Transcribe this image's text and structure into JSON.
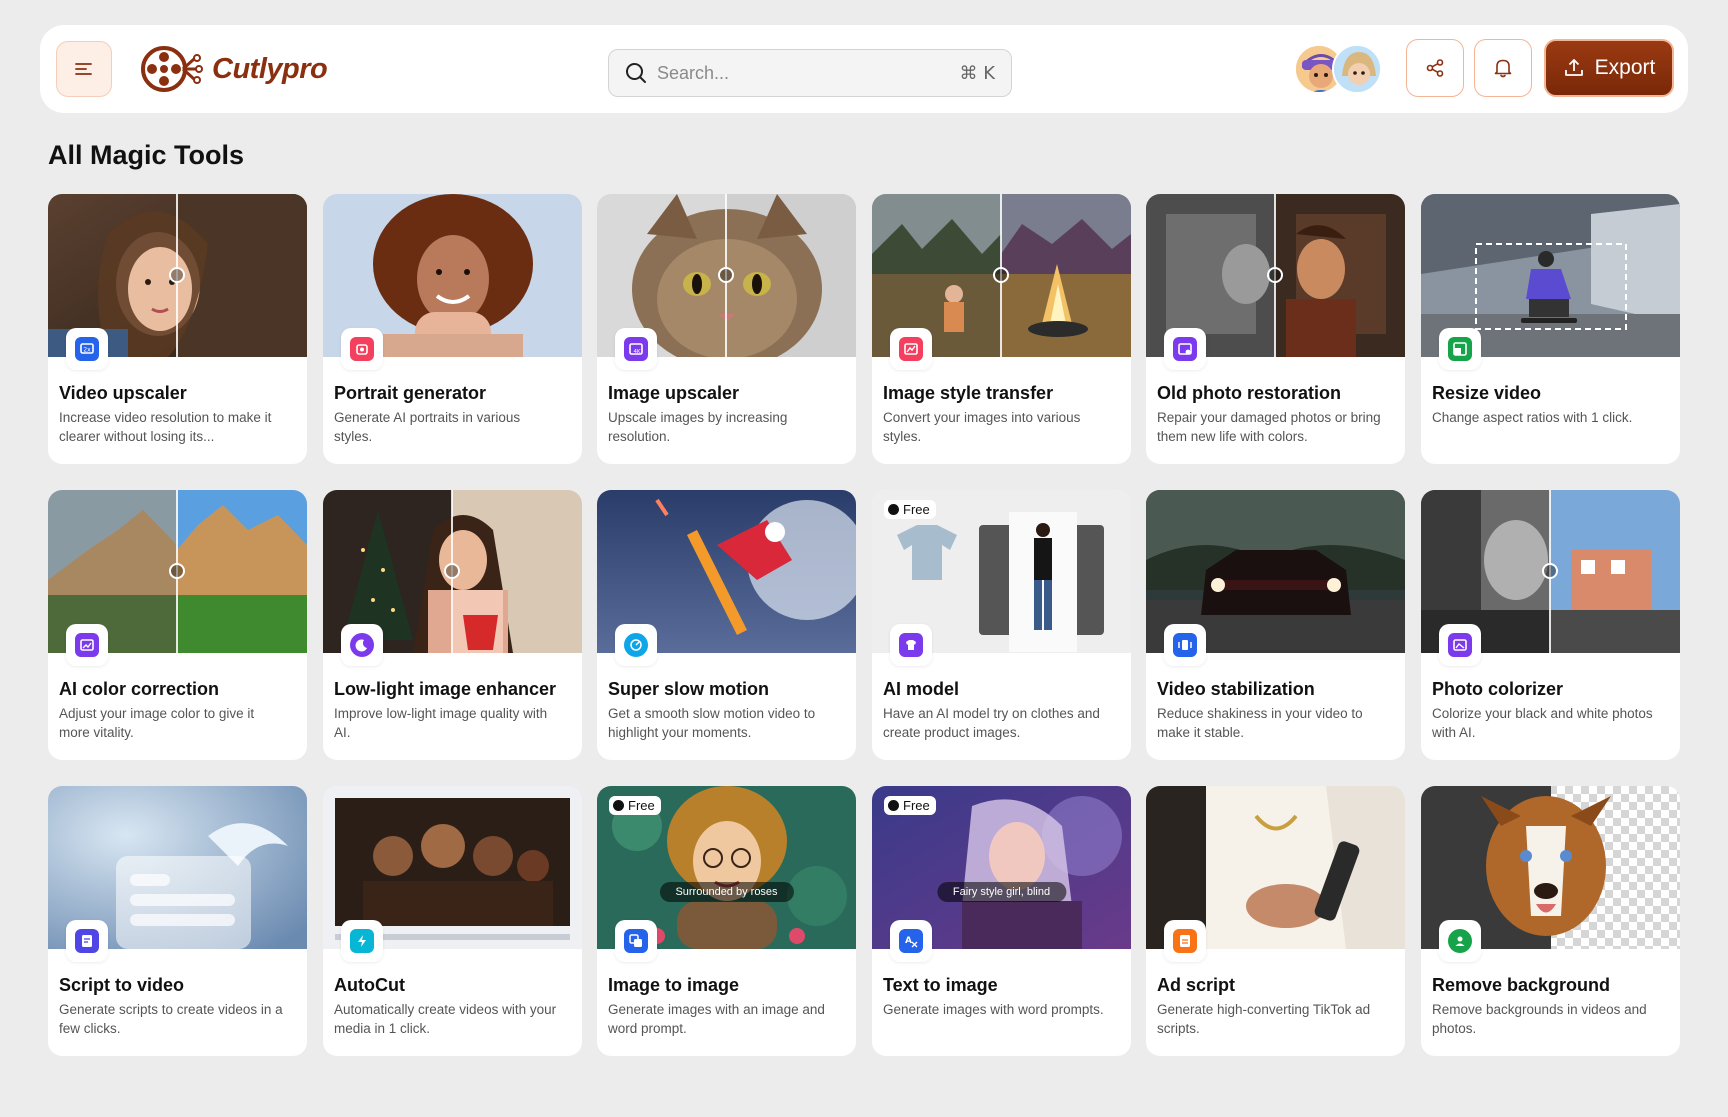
{
  "header": {
    "logo_text": "Cutlypro",
    "search_placeholder": "Search...",
    "search_shortcut": "⌘ K",
    "export_label": "Export",
    "brand_color": "#8a3010"
  },
  "page": {
    "title": "All Magic Tools"
  },
  "tools": [
    {
      "title": "Video upscaler",
      "desc": "Increase video resolution to make it clearer without losing its...",
      "icon": "video-upscale-icon",
      "badge_color": "#2563eb",
      "free": false
    },
    {
      "title": "Portrait generator",
      "desc": "Generate AI portraits in various styles.",
      "icon": "portrait-icon",
      "badge_color": "#f43f5e",
      "free": false
    },
    {
      "title": "Image upscaler",
      "desc": "Upscale images by increasing resolution.",
      "icon": "image-upscale-icon",
      "badge_color": "#7c3aed",
      "free": false
    },
    {
      "title": "Image style transfer",
      "desc": "Convert your images into various styles.",
      "icon": "style-transfer-icon",
      "badge_color": "#f43f5e",
      "free": false
    },
    {
      "title": "Old photo restoration",
      "desc": "Repair your damaged photos or bring them new life with colors.",
      "icon": "photo-restore-icon",
      "badge_color": "#7c3aed",
      "free": false
    },
    {
      "title": "Resize video",
      "desc": "Change aspect ratios with 1 click.",
      "icon": "resize-icon",
      "badge_color": "#16a34a",
      "free": false
    },
    {
      "title": "AI color correction",
      "desc": "Adjust your image color to give it more vitality.",
      "icon": "color-correction-icon",
      "badge_color": "#7c3aed",
      "free": false
    },
    {
      "title": "Low-light image enhancer",
      "desc": "Improve low-light image quality with AI.",
      "icon": "moon-icon",
      "badge_color": "#7c3aed",
      "free": false
    },
    {
      "title": "Super slow motion",
      "desc": "Get a smooth slow motion video to highlight your moments.",
      "icon": "slow-motion-icon",
      "badge_color": "#0ea5e9",
      "free": false
    },
    {
      "title": "AI model",
      "desc": "Have an AI model try on clothes and create product images.",
      "icon": "tshirt-icon",
      "badge_color": "#7c3aed",
      "free": true
    },
    {
      "title": "Video stabilization",
      "desc": "Reduce shakiness in your video to make it stable.",
      "icon": "stabilize-icon",
      "badge_color": "#2563eb",
      "free": false
    },
    {
      "title": "Photo colorizer",
      "desc": "Colorize your black and white photos with AI.",
      "icon": "colorize-icon",
      "badge_color": "#7c3aed",
      "free": false
    },
    {
      "title": "Script to video",
      "desc": "Generate scripts to create videos in a few clicks.",
      "icon": "script-icon",
      "badge_color": "#4f46e5",
      "free": false
    },
    {
      "title": "AutoCut",
      "desc": "Automatically create videos with your media in 1 click.",
      "icon": "autocut-icon",
      "badge_color": "#06b6d4",
      "free": false
    },
    {
      "title": "Image to image",
      "desc": "Generate images with an image and word prompt.",
      "icon": "image-to-image-icon",
      "badge_color": "#2563eb",
      "free": true,
      "caption": "Surrounded by roses"
    },
    {
      "title": "Text to image",
      "desc": "Generate images with word prompts.",
      "icon": "text-to-image-icon",
      "badge_color": "#2563eb",
      "free": true,
      "caption": "Fairy style girl, blind"
    },
    {
      "title": "Ad script",
      "desc": "Generate high-converting TikTok ad scripts.",
      "icon": "ad-script-icon",
      "badge_color": "#f97316",
      "free": false
    },
    {
      "title": "Remove background",
      "desc": "Remove backgrounds in videos and photos.",
      "icon": "remove-bg-icon",
      "badge_color": "#16a34a",
      "free": false
    }
  ],
  "labels": {
    "free": "Free"
  }
}
